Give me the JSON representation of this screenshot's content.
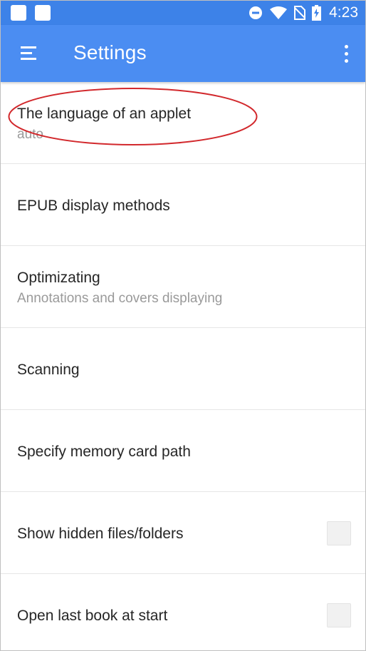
{
  "status_bar": {
    "time": "4:23"
  },
  "app_bar": {
    "title": "Settings"
  },
  "settings": {
    "items": [
      {
        "title": "The language of an applet",
        "subtitle": "auto"
      },
      {
        "title": "EPUB display methods"
      },
      {
        "title": "Optimizating",
        "subtitle": "Annotations and covers displaying"
      },
      {
        "title": "Scanning"
      },
      {
        "title": "Specify memory card path"
      },
      {
        "title": "Show hidden files/folders",
        "checked": false
      },
      {
        "title": "Open last book at start",
        "checked": false
      }
    ]
  },
  "colors": {
    "status_bar": "#3d82e8",
    "app_bar": "#4b8df2",
    "annotation_ellipse": "#d2282c"
  }
}
